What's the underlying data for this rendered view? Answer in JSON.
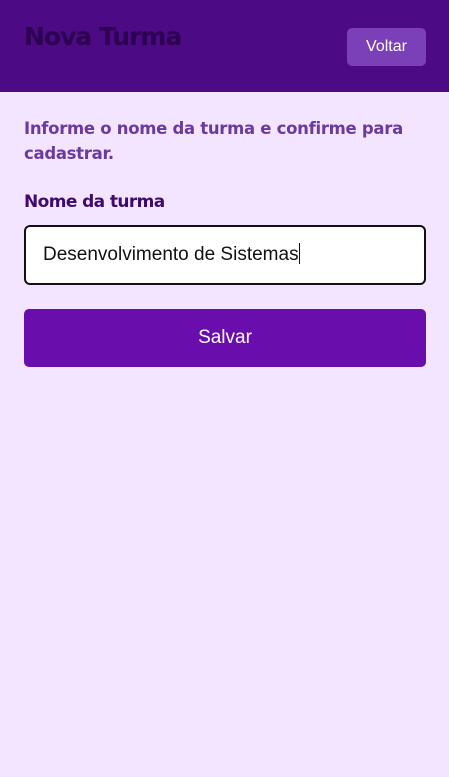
{
  "header": {
    "title": "Nova Turma",
    "back_label": "Voltar"
  },
  "form": {
    "instruction": "Informe o nome da turma e confirme para cadastrar.",
    "field_label": "Nome da turma",
    "field_value": "Desenvolvimento de Sistemas",
    "save_label": "Salvar"
  },
  "colors": {
    "header_bg": "#4C0A84",
    "page_bg": "#F3E5FF",
    "primary_button": "#6A0DAD",
    "secondary_button": "#7B3FB8",
    "instruction_text": "#6A3A9E",
    "label_text": "#3E0A6B"
  }
}
